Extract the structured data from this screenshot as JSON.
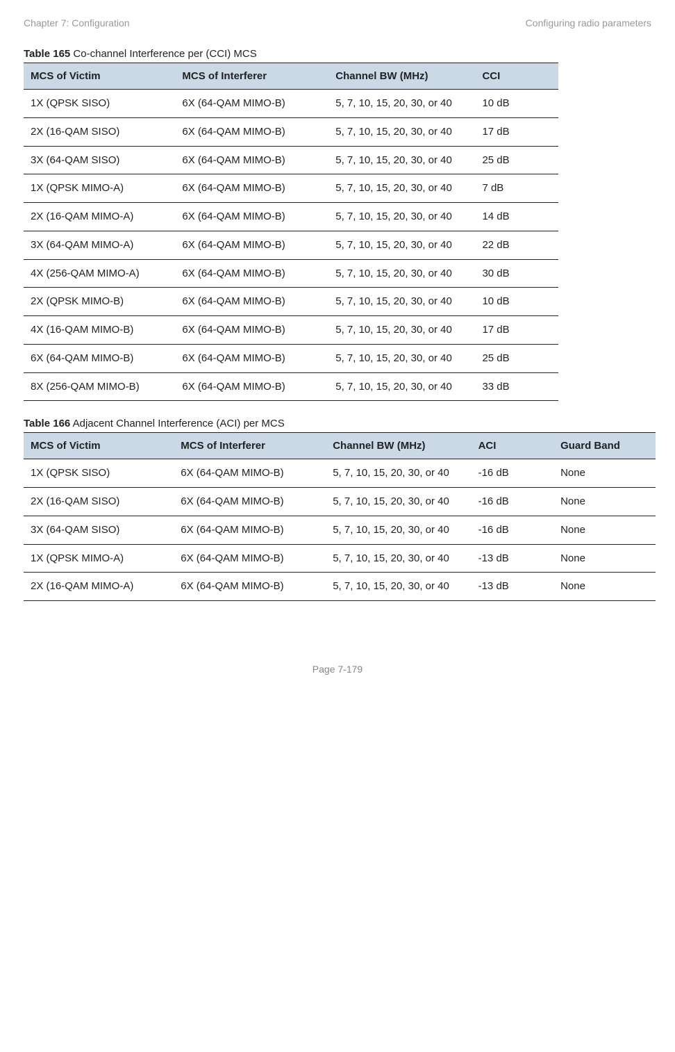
{
  "header": {
    "left": "Chapter 7:  Configuration",
    "right": "Configuring radio parameters"
  },
  "table165": {
    "caption_bold": "Table 165",
    "caption_rest": " Co-channel Interference per (CCI) MCS",
    "headers": {
      "victim": "MCS of Victim",
      "interferer": "MCS of Interferer",
      "bw": "Channel BW (MHz)",
      "cci": "CCI"
    },
    "rows": [
      {
        "victim": "1X (QPSK SISO)",
        "interferer": "6X (64-QAM MIMO-B)",
        "bw": "5, 7, 10, 15, 20, 30, or 40",
        "cci": "10 dB"
      },
      {
        "victim": "2X (16-QAM SISO)",
        "interferer": "6X (64-QAM MIMO-B)",
        "bw": "5, 7, 10, 15, 20, 30, or 40",
        "cci": "17 dB"
      },
      {
        "victim": "3X (64-QAM SISO)",
        "interferer": "6X (64-QAM MIMO-B)",
        "bw": "5, 7, 10, 15, 20, 30, or 40",
        "cci": "25 dB"
      },
      {
        "victim": "1X (QPSK MIMO-A)",
        "interferer": "6X (64-QAM MIMO-B)",
        "bw": "5, 7, 10, 15, 20, 30, or 40",
        "cci": "7 dB"
      },
      {
        "victim": "2X (16-QAM MIMO-A)",
        "interferer": "6X (64-QAM MIMO-B)",
        "bw": "5, 7, 10, 15, 20, 30, or 40",
        "cci": "14 dB"
      },
      {
        "victim": "3X (64-QAM MIMO-A)",
        "interferer": "6X (64-QAM MIMO-B)",
        "bw": "5, 7, 10, 15, 20, 30, or 40",
        "cci": "22 dB"
      },
      {
        "victim": "4X (256-QAM MIMO-A)",
        "interferer": "6X (64-QAM MIMO-B)",
        "bw": "5, 7, 10, 15, 20, 30, or 40",
        "cci": "30 dB"
      },
      {
        "victim": "2X (QPSK MIMO-B)",
        "interferer": "6X (64-QAM MIMO-B)",
        "bw": "5, 7, 10, 15, 20, 30, or 40",
        "cci": "10 dB"
      },
      {
        "victim": "4X (16-QAM MIMO-B)",
        "interferer": "6X (64-QAM MIMO-B)",
        "bw": "5, 7, 10, 15, 20, 30, or 40",
        "cci": "17 dB"
      },
      {
        "victim": "6X (64-QAM MIMO-B)",
        "interferer": "6X (64-QAM MIMO-B)",
        "bw": "5, 7, 10, 15, 20, 30, or 40",
        "cci": "25 dB"
      },
      {
        "victim": "8X (256-QAM MIMO-B)",
        "interferer": "6X (64-QAM MIMO-B)",
        "bw": "5, 7, 10, 15, 20, 30, or 40",
        "cci": "33 dB"
      }
    ]
  },
  "table166": {
    "caption_bold": "Table 166",
    "caption_rest": " Adjacent Channel Interference (ACI) per MCS",
    "headers": {
      "victim": "MCS of Victim",
      "interferer": "MCS of Interferer",
      "bw": "Channel BW (MHz)",
      "aci": "ACI",
      "guard": "Guard Band"
    },
    "rows": [
      {
        "victim": "1X (QPSK SISO)",
        "interferer": "6X (64-QAM MIMO-B)",
        "bw": "5, 7, 10, 15, 20, 30, or 40",
        "aci": "-16 dB",
        "guard": "None"
      },
      {
        "victim": "2X (16-QAM SISO)",
        "interferer": "6X (64-QAM MIMO-B)",
        "bw": "5, 7, 10, 15, 20, 30, or 40",
        "aci": "-16 dB",
        "guard": "None"
      },
      {
        "victim": "3X (64-QAM SISO)",
        "interferer": "6X (64-QAM MIMO-B)",
        "bw": "5, 7, 10, 15, 20, 30, or 40",
        "aci": "-16 dB",
        "guard": "None"
      },
      {
        "victim": "1X (QPSK MIMO-A)",
        "interferer": "6X (64-QAM MIMO-B)",
        "bw": "5, 7, 10, 15, 20, 30, or 40",
        "aci": "-13 dB",
        "guard": "None"
      },
      {
        "victim": "2X (16-QAM MIMO-A)",
        "interferer": "6X (64-QAM MIMO-B)",
        "bw": "5, 7, 10, 15, 20, 30, or 40",
        "aci": "-13 dB",
        "guard": "None"
      }
    ]
  },
  "footer": "Page 7-179"
}
